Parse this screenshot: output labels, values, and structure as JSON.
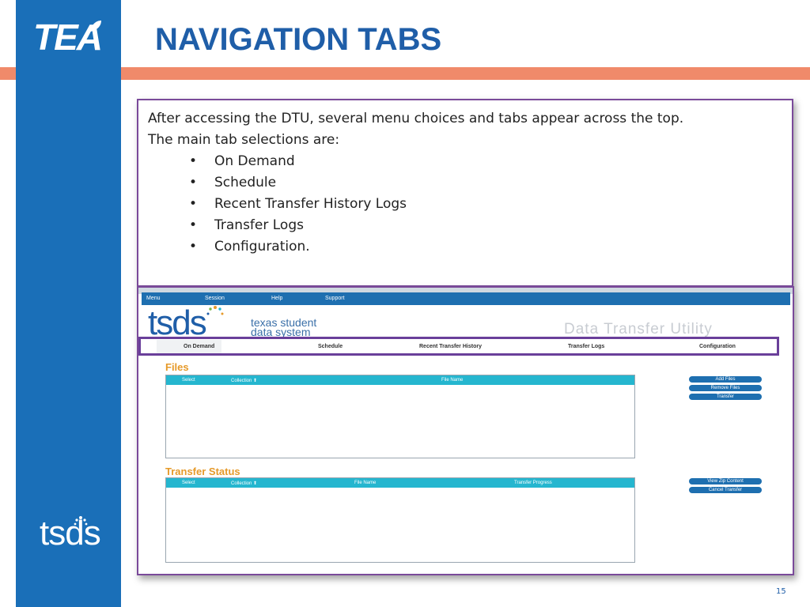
{
  "slide": {
    "title": "NAVIGATION TABS",
    "page_number": "15",
    "logo_text": "TEA",
    "footer_logo_text": "tsds",
    "colors": {
      "sidebar": "#1a6fb8",
      "title": "#1f5ea8",
      "stripe": "#f08a6a",
      "box_border": "#7a4a9a"
    }
  },
  "text_box": {
    "line1": "After accessing the DTU, several menu choices and tabs appear across the top.",
    "line2": "The main tab selections are:",
    "bullets": [
      "On Demand",
      "Schedule",
      "Recent Transfer History Logs",
      "Transfer Logs",
      "Configuration."
    ]
  },
  "screenshot": {
    "menu": [
      "Menu",
      "Session",
      "Help",
      "Support"
    ],
    "logo": "tsds",
    "logo_sub1": "texas student",
    "logo_sub2": "data system",
    "app_title": "Data Transfer Utility",
    "tabs": [
      "On Demand",
      "Schedule",
      "Recent Transfer History",
      "Transfer Logs",
      "Configuration"
    ],
    "files_label": "Files",
    "files_columns": [
      "Select",
      "Collection ⬆",
      "File Name"
    ],
    "files_buttons": [
      "Add Files",
      "Remove Files",
      "Transfer"
    ],
    "transfer_label": "Transfer Status",
    "transfer_columns": [
      "Select",
      "Collection ⬆",
      "File Name",
      "Transfer Progress"
    ],
    "transfer_buttons": [
      "View Zip Content",
      "Cancel Transfer"
    ]
  }
}
